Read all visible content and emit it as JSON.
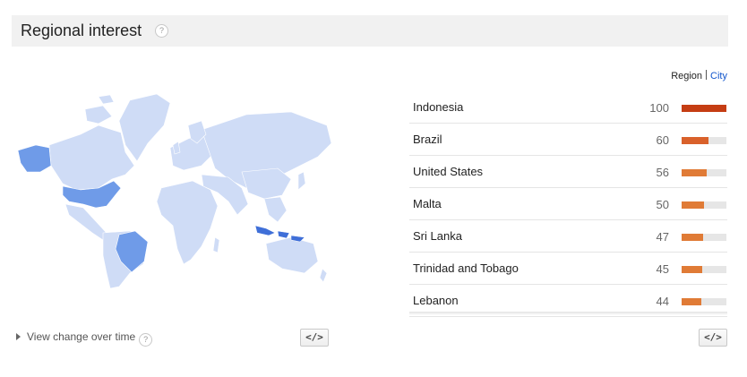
{
  "header": {
    "title": "Regional interest",
    "help": "?"
  },
  "view_toggle": {
    "region": "Region",
    "city": "City"
  },
  "map": {
    "highlight_color": "#6f9be8",
    "base_color": "#cfdcf6",
    "dark_color": "#3f6fd8"
  },
  "regions": [
    {
      "name": "Indonesia",
      "value": "100",
      "score": 100,
      "color": "#c53d13"
    },
    {
      "name": "Brazil",
      "value": "60",
      "score": 60,
      "color": "#d9612b"
    },
    {
      "name": "United States",
      "value": "56",
      "score": 56,
      "color": "#e07b36"
    },
    {
      "name": "Malta",
      "value": "50",
      "score": 50,
      "color": "#e07b36"
    },
    {
      "name": "Sri Lanka",
      "value": "47",
      "score": 47,
      "color": "#e07b36"
    },
    {
      "name": "Trinidad and Tobago",
      "value": "45",
      "score": 45,
      "color": "#e07b36"
    },
    {
      "name": "Lebanon",
      "value": "44",
      "score": 44,
      "color": "#e07b36"
    }
  ],
  "footer": {
    "view_change": "View change over time",
    "help": "?",
    "embed_icon": "</>"
  }
}
